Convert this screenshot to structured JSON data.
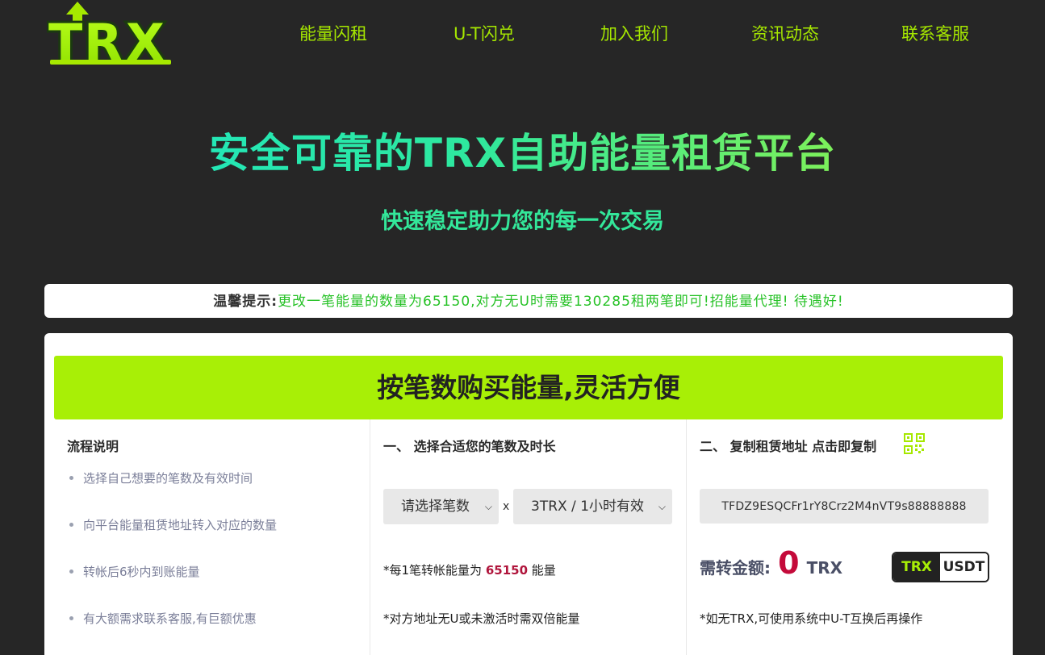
{
  "logo": {
    "text": "TRX"
  },
  "nav": {
    "items": [
      "能量闪租",
      "U-T闪兑",
      "加入我们",
      "资讯动态",
      "联系客服"
    ]
  },
  "hero": {
    "title": "安全可靠的TRX自助能量租赁平台",
    "subtitle": "快速稳定助力您的每一次交易"
  },
  "notice": {
    "label": "温馨提示:",
    "message": "更改一笔能量的数量为65150,对方无U时需要130285租两笔即可!招能量代理! 待遇好!"
  },
  "banner": {
    "title": "按笔数购买能量,灵活方便"
  },
  "process": {
    "heading": "流程说明",
    "steps": [
      "选择自己想要的笔数及有效时间",
      "向平台能量租赁地址转入对应的数量",
      "转帐后6秒内到账能量",
      "有大额需求联系客服,有巨额优惠"
    ]
  },
  "select": {
    "heading": "一、 选择合适您的笔数及时长",
    "count_value": "请选择笔数",
    "times_sign": "x",
    "duration_value": "3TRX / 1小时有效",
    "note1_prefix": "*每1笔转帐能量为",
    "note1_value": "65150",
    "note1_suffix": "能量",
    "note2": "*对方地址无U或未激活时需双倍能量"
  },
  "copy": {
    "heading": "二、 复制租赁地址 点击即复制",
    "address": "TFDZ9ESQCFr1rY8Crz2M4nVT9s88888888",
    "amount_label": "需转金额:",
    "amount_value": "0",
    "amount_unit": "TRX",
    "toggle": [
      "TRX",
      "USDT"
    ],
    "note": "*如无TRX,可使用系统中U-T互换后再操作"
  },
  "colors": {
    "accent": "#a8ef06",
    "nav": "#a6e800",
    "highlight": "#c40a3a",
    "notice_text": "#27c227"
  },
  "icons": {
    "qr": "qr-code-icon",
    "logo": "trx-logo-icon"
  }
}
